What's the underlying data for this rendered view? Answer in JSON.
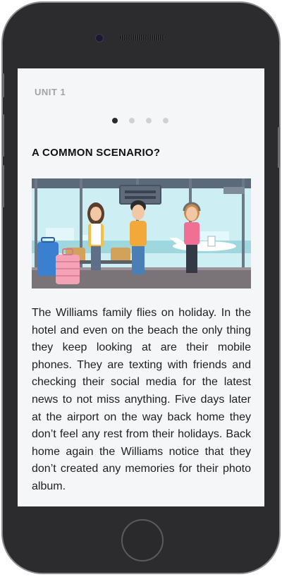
{
  "unit_label": "UNIT 1",
  "pagination": {
    "total": 4,
    "active": 0
  },
  "title": "A COMMON SCENARIO?",
  "illustration": {
    "icon": "airport-family-illustration"
  },
  "paragraph": "The Williams family flies on holiday. In the hotel and even on the beach the only thing they keep looking at are their mobile phones. They are texting with friends and checking their social media for the latest news to not miss anything. Five days later at the airport on the way back home they don’t feel any rest from their holidays. Back home again the Williams notice that they don’t created any memories for their photo album."
}
